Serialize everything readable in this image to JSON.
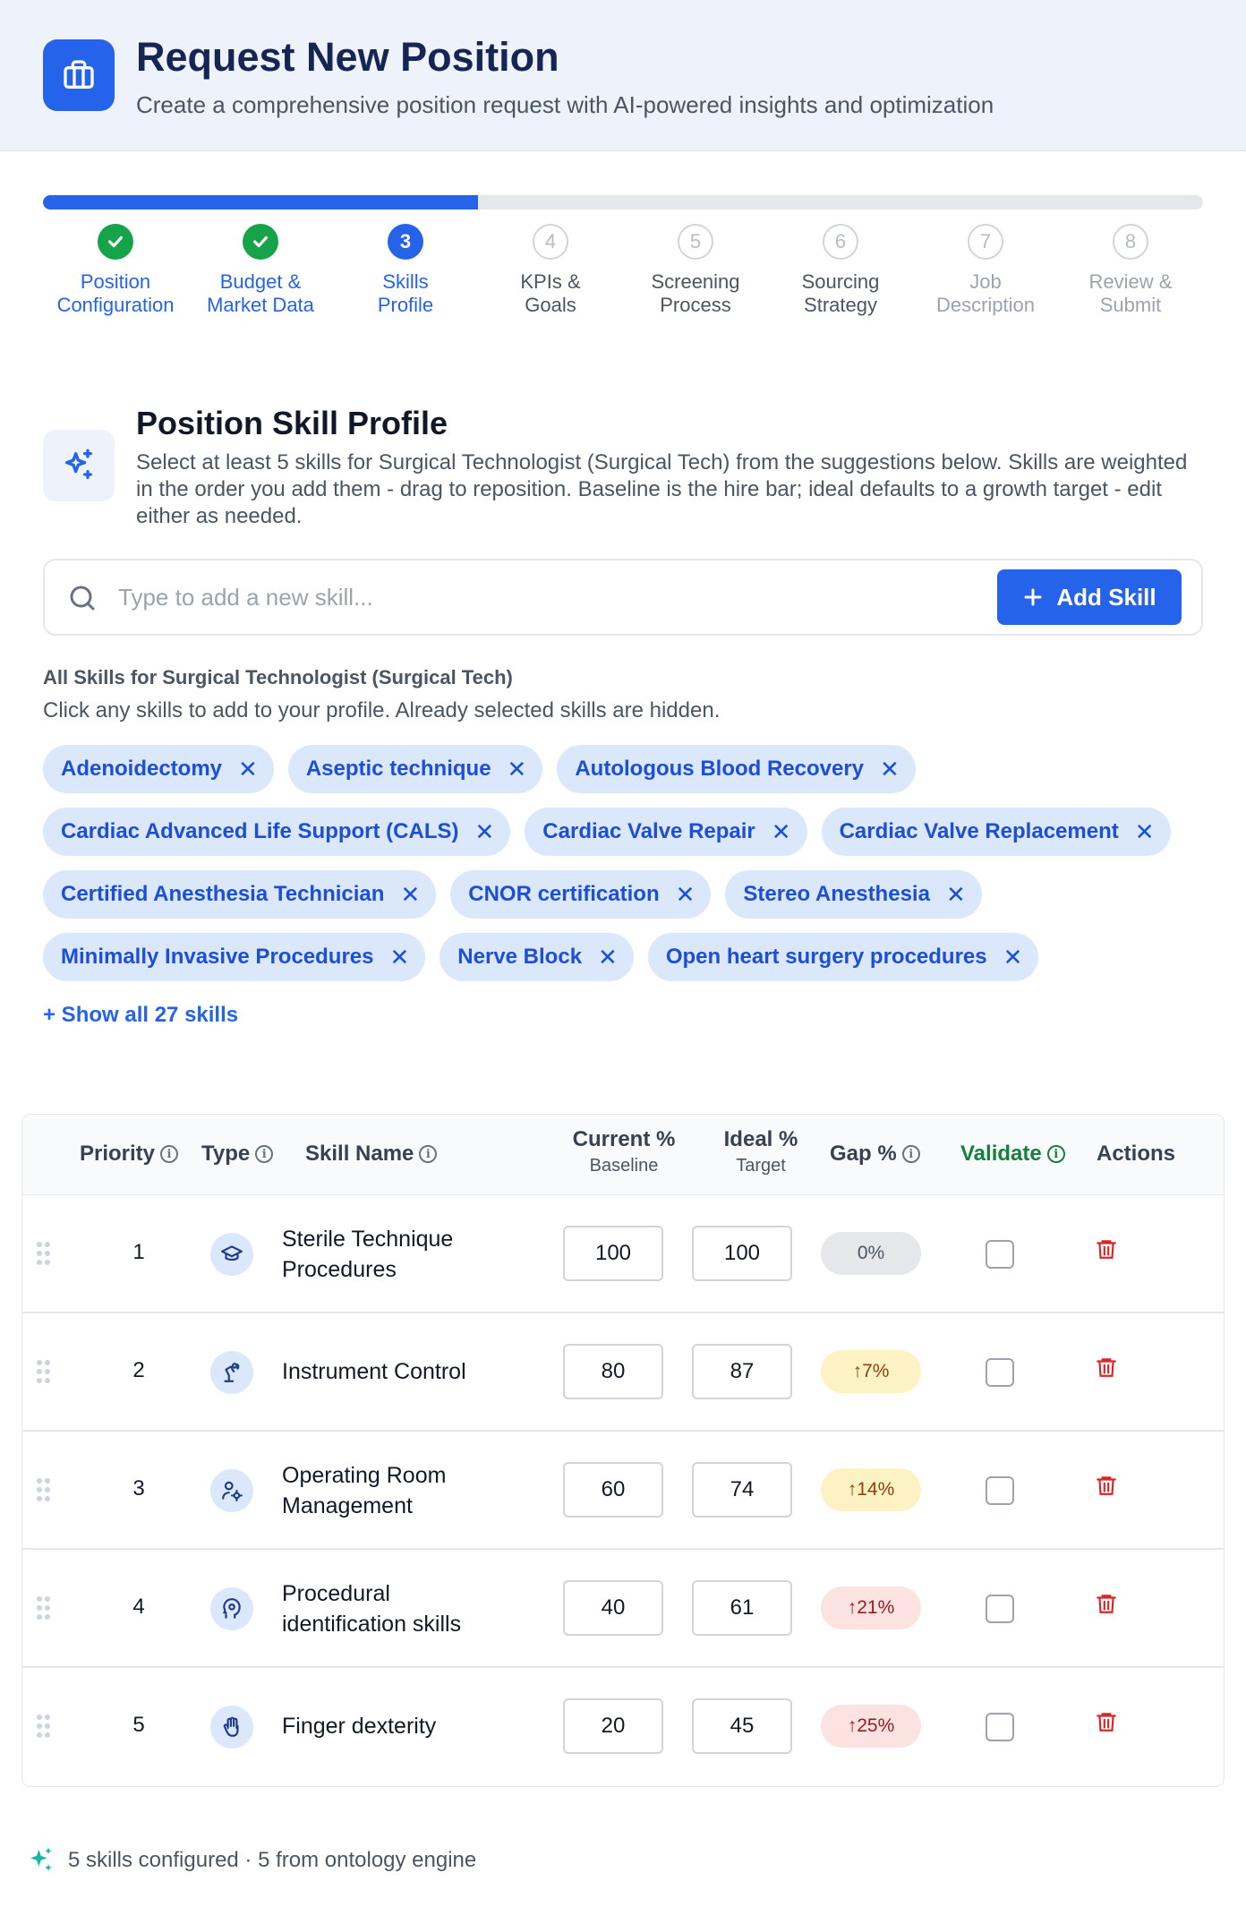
{
  "header": {
    "title": "Request New Position",
    "subtitle": "Create a comprehensive position request with AI-powered insights and optimization"
  },
  "progress": {
    "fraction": 0.375
  },
  "steps": [
    {
      "num": "1",
      "line1": "Position",
      "line2": "Configuration",
      "state": "done"
    },
    {
      "num": "2",
      "line1": "Budget &",
      "line2": "Market Data",
      "state": "done"
    },
    {
      "num": "3",
      "line1": "Skills",
      "line2": "Profile",
      "state": "active"
    },
    {
      "num": "4",
      "line1": "KPIs &",
      "line2": "Goals",
      "state": "next"
    },
    {
      "num": "5",
      "line1": "Screening",
      "line2": "Process",
      "state": "next"
    },
    {
      "num": "6",
      "line1": "Sourcing",
      "line2": "Strategy",
      "state": "next"
    },
    {
      "num": "7",
      "line1": "Job",
      "line2": "Description",
      "state": "far"
    },
    {
      "num": "8",
      "line1": "Review &",
      "line2": "Submit",
      "state": "far"
    }
  ],
  "section": {
    "title": "Position Skill Profile",
    "description": "Select at least 5 skills for Surgical Technologist (Surgical Tech) from the suggestions below. Skills are weighted in the order you add them - drag to reposition. Baseline is the hire bar; ideal defaults to a growth target - edit either as needed."
  },
  "search": {
    "placeholder": "Type to add a new skill...",
    "value": "",
    "add_label": "Add Skill"
  },
  "all_skills": {
    "title": "All Skills for Surgical Technologist (Surgical Tech)",
    "subtitle": "Click any skills to add to your profile. Already selected skills are hidden.",
    "rows": [
      [
        "Adenoidectomy",
        "Aseptic technique",
        "Autologous Blood Recovery"
      ],
      [
        "Cardiac Advanced Life Support (CALS)",
        "Cardiac Valve Repair",
        "Cardiac Valve Replacement"
      ],
      [
        "Certified Anesthesia Technician",
        "CNOR certification",
        "Stereo Anesthesia"
      ],
      [
        "Minimally Invasive Procedures",
        "Nerve Block",
        "Open heart surgery procedures"
      ]
    ],
    "show_all": "+ Show all 27 skills"
  },
  "table": {
    "headers": {
      "priority": "Priority",
      "type": "Type",
      "skill_name": "Skill Name",
      "current": "Current %",
      "current_sub": "Baseline",
      "ideal": "Ideal %",
      "ideal_sub": "Target",
      "gap": "Gap %",
      "validate": "Validate",
      "actions": "Actions"
    },
    "rows": [
      {
        "priority": "1",
        "icon": "graduation-cap-icon",
        "name": "Sterile Technique Procedures",
        "current": "100",
        "ideal": "100",
        "gap": "0%",
        "gap_level": "neutral"
      },
      {
        "priority": "2",
        "icon": "robot-arm-icon",
        "name": "Instrument Control",
        "current": "80",
        "ideal": "87",
        "gap": "↑7%",
        "gap_level": "yellow"
      },
      {
        "priority": "3",
        "icon": "user-gear-icon",
        "name": "Operating Room Management",
        "current": "60",
        "ideal": "74",
        "gap": "↑14%",
        "gap_level": "yellow"
      },
      {
        "priority": "4",
        "icon": "brain-head-icon",
        "name": "Procedural identification skills",
        "current": "40",
        "ideal": "61",
        "gap": "↑21%",
        "gap_level": "red"
      },
      {
        "priority": "5",
        "icon": "hand-icon",
        "name": "Finger dexterity",
        "current": "20",
        "ideal": "45",
        "gap": "↑25%",
        "gap_level": "red"
      }
    ]
  },
  "footer": {
    "text": "5 skills configured · 5 from ontology engine"
  },
  "colors": {
    "accent": "#2563eb",
    "done": "#16a34a",
    "chip_bg": "#dbe8fb",
    "trash": "#dc2626",
    "validate": "#15803d"
  }
}
